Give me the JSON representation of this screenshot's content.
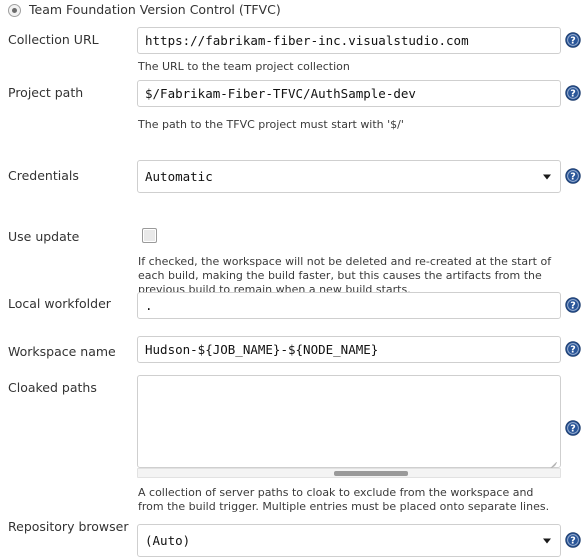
{
  "form": {
    "scm_option": {
      "label": "Team Foundation Version Control (TFVC)",
      "selected": true
    },
    "rows": [
      {
        "key": "collection_url",
        "label": "Collection URL",
        "type": "text",
        "value": "https://fabrikam-fiber-inc.visualstudio.com",
        "help": "The URL to the team project collection",
        "has_help_icon": true
      },
      {
        "key": "project_path",
        "label": "Project path",
        "type": "text",
        "value": "$/Fabrikam-Fiber-TFVC/AuthSample-dev",
        "help": "The path to the TFVC project must start with '$/'",
        "has_help_icon": true
      },
      {
        "key": "credentials",
        "label": "Credentials",
        "type": "select",
        "value": "Automatic",
        "options": [
          "Automatic"
        ],
        "help": "",
        "has_help_icon": true
      },
      {
        "key": "use_update",
        "label": "Use update",
        "type": "checkbox",
        "checked": false,
        "help": "If checked, the workspace will not be deleted and re-created at the start of each build, making the build faster, but this causes the artifacts from the previous build to remain when a new build starts.",
        "has_help_icon": false
      },
      {
        "key": "local_workfolder",
        "label": "Local workfolder",
        "type": "text",
        "value": ".",
        "help": "",
        "has_help_icon": true
      },
      {
        "key": "workspace_name",
        "label": "Workspace name",
        "type": "text",
        "value": "Hudson-${JOB_NAME}-${NODE_NAME}",
        "help": "",
        "has_help_icon": true
      },
      {
        "key": "cloaked_paths",
        "label": "Cloaked paths",
        "type": "textarea",
        "value": "",
        "help": "A collection of server paths to cloak to exclude from the workspace and from the build trigger. Multiple entries must be placed onto separate lines.",
        "has_help_icon": true
      },
      {
        "key": "repository_browser",
        "label": "Repository browser",
        "type": "select",
        "value": "(Auto)",
        "options": [
          "(Auto)"
        ],
        "help": "",
        "has_help_icon": true
      }
    ]
  },
  "icons": {
    "help": "question-mark-circle-icon",
    "help_title": "Help for feature",
    "caret": "chevron-down-icon"
  },
  "colors": {
    "help_icon_blue": "#2a5699",
    "border": "#cfcfcf",
    "text": "#333333",
    "field_text": "#111111"
  }
}
